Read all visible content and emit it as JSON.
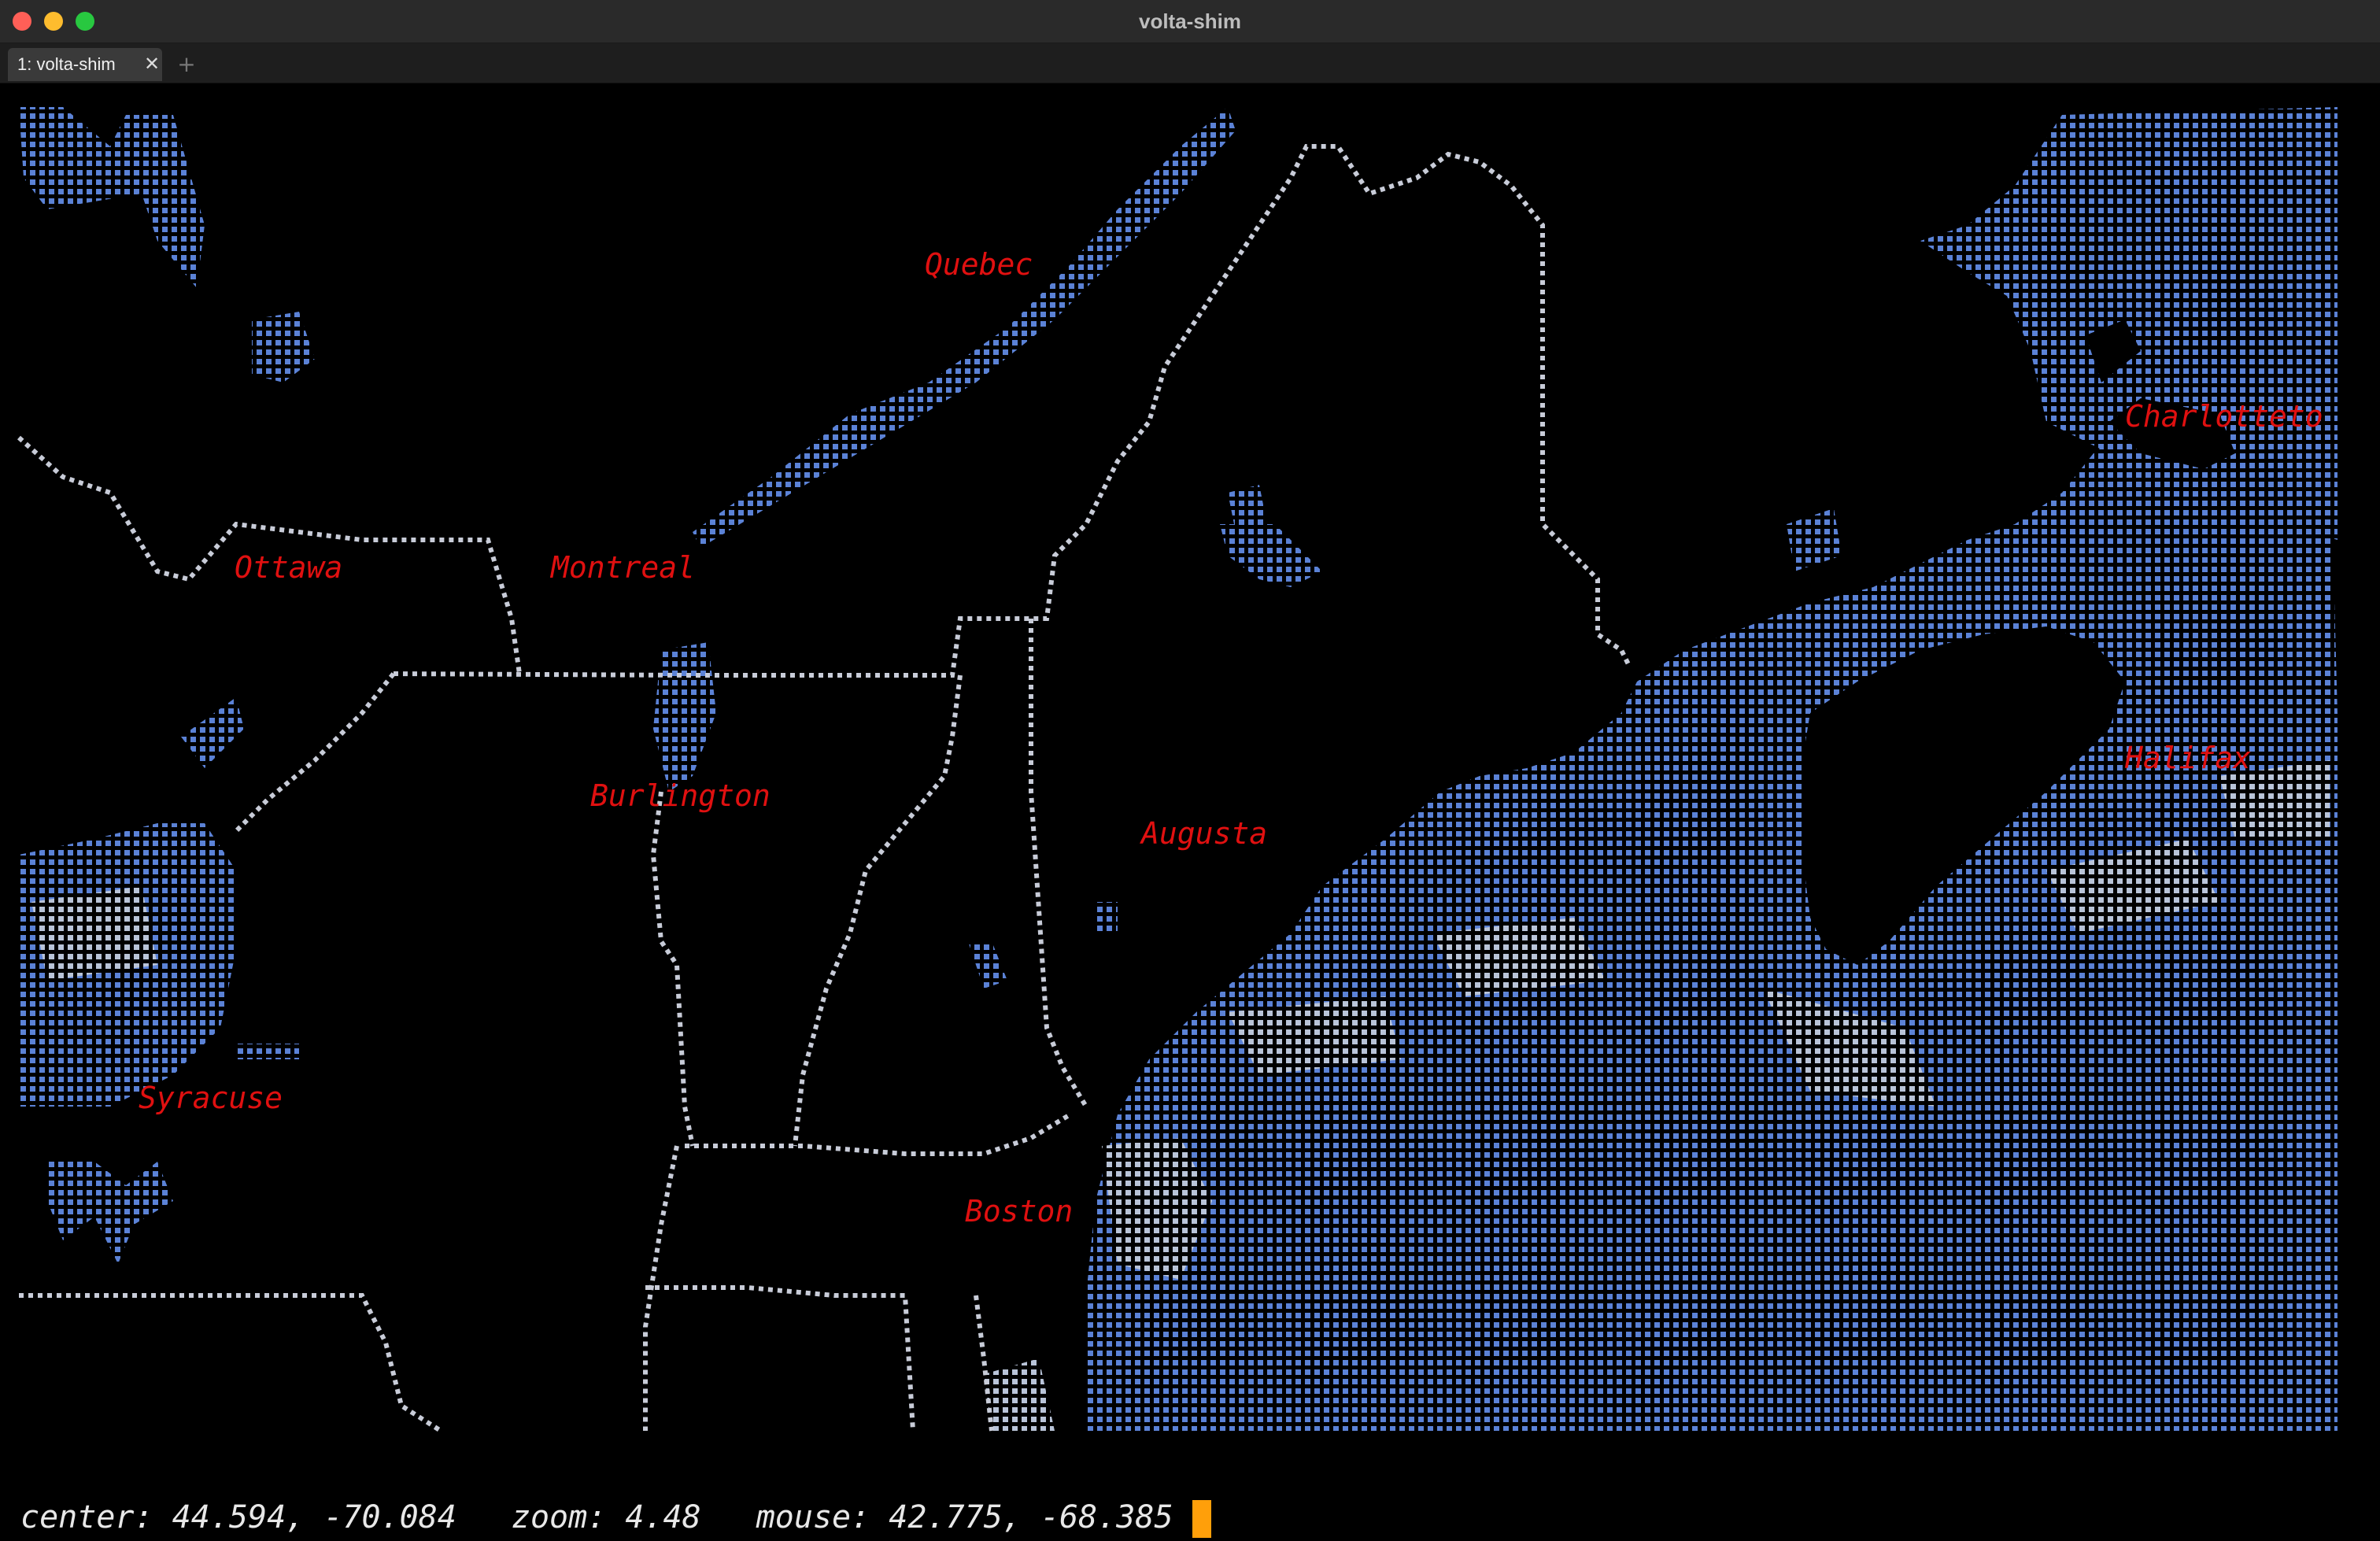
{
  "window": {
    "title": "volta-shim"
  },
  "tabs": [
    {
      "label": "1: volta-shim"
    }
  ],
  "tab_add_symbol": "+",
  "tab_close_symbol": "✕",
  "status": {
    "center": "center: 44.594, -70.084",
    "zoom": "zoom: 4.48",
    "mouse": "mouse: 42.775, -68.385"
  },
  "cities": {
    "quebec": "Quebec",
    "ottawa": "Ottawa",
    "montreal": "Montreal",
    "charlottetown": "Charlotteto",
    "burlington": "Burlington",
    "augusta": "Augusta",
    "halifax": "Halifax",
    "syracuse": "Syracuse",
    "boston": "Boston"
  },
  "colors": {
    "water": "#5b82d6",
    "water_light": "#b9c4d8",
    "border": "#c8ccd8",
    "city_label": "#e01010",
    "cursor": "#ff9f0a"
  },
  "icons": {
    "close": "close-icon",
    "minimize": "minimize-icon",
    "maximize": "maximize-icon",
    "tab_close": "tab-close-icon",
    "tab_add": "plus-icon"
  }
}
